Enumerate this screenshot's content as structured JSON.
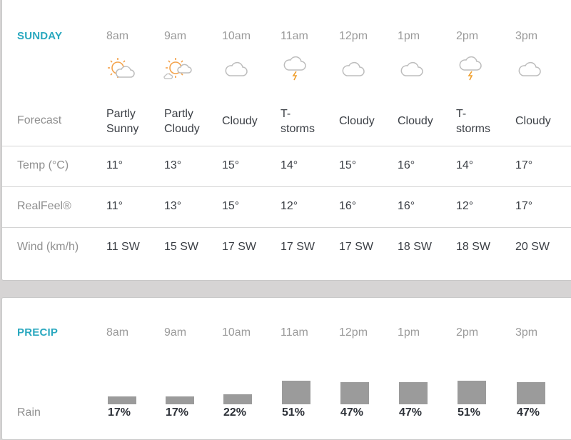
{
  "hourly": {
    "title": "SUNDAY",
    "hours": [
      "8am",
      "9am",
      "10am",
      "11am",
      "12pm",
      "1pm",
      "2pm",
      "3pm"
    ],
    "icons": [
      "partly-sunny-icon",
      "partly-cloudy-icon",
      "cloudy-icon",
      "thunderstorm-icon",
      "cloudy-icon",
      "cloudy-icon",
      "thunderstorm-icon",
      "cloudy-icon"
    ],
    "rows": {
      "forecast": {
        "label": "Forecast",
        "values": [
          [
            "Partly",
            "Sunny"
          ],
          [
            "Partly",
            "Cloudy"
          ],
          [
            "Cloudy"
          ],
          [
            "T-",
            "storms"
          ],
          [
            "Cloudy"
          ],
          [
            "Cloudy"
          ],
          [
            "T-",
            "storms"
          ],
          [
            "Cloudy"
          ]
        ]
      },
      "temp": {
        "label": "Temp (°C)",
        "values": [
          "11°",
          "13°",
          "15°",
          "14°",
          "15°",
          "16°",
          "14°",
          "17°"
        ]
      },
      "realfeel": {
        "label": "RealFeel®",
        "values": [
          "11°",
          "13°",
          "15°",
          "12°",
          "16°",
          "16°",
          "12°",
          "17°"
        ]
      },
      "wind": {
        "label": "Wind (km/h)",
        "values": [
          "11 SW",
          "15 SW",
          "17 SW",
          "17 SW",
          "17 SW",
          "18 SW",
          "18 SW",
          "20 SW"
        ]
      }
    }
  },
  "precip": {
    "title": "PRECIP",
    "hours": [
      "8am",
      "9am",
      "10am",
      "11am",
      "12pm",
      "1pm",
      "2pm",
      "3pm"
    ],
    "rain_label": "Rain",
    "rain_percent": [
      17,
      17,
      22,
      51,
      47,
      47,
      51,
      47
    ],
    "rain_labels": [
      "17%",
      "17%",
      "22%",
      "51%",
      "47%",
      "47%",
      "51%",
      "47%"
    ]
  },
  "colors": {
    "accent": "#2aa8bf",
    "sun": "#f4a24a",
    "cloud": "#bdbdbd",
    "bolt": "#f0a030",
    "bar": "#9b9b9b"
  }
}
